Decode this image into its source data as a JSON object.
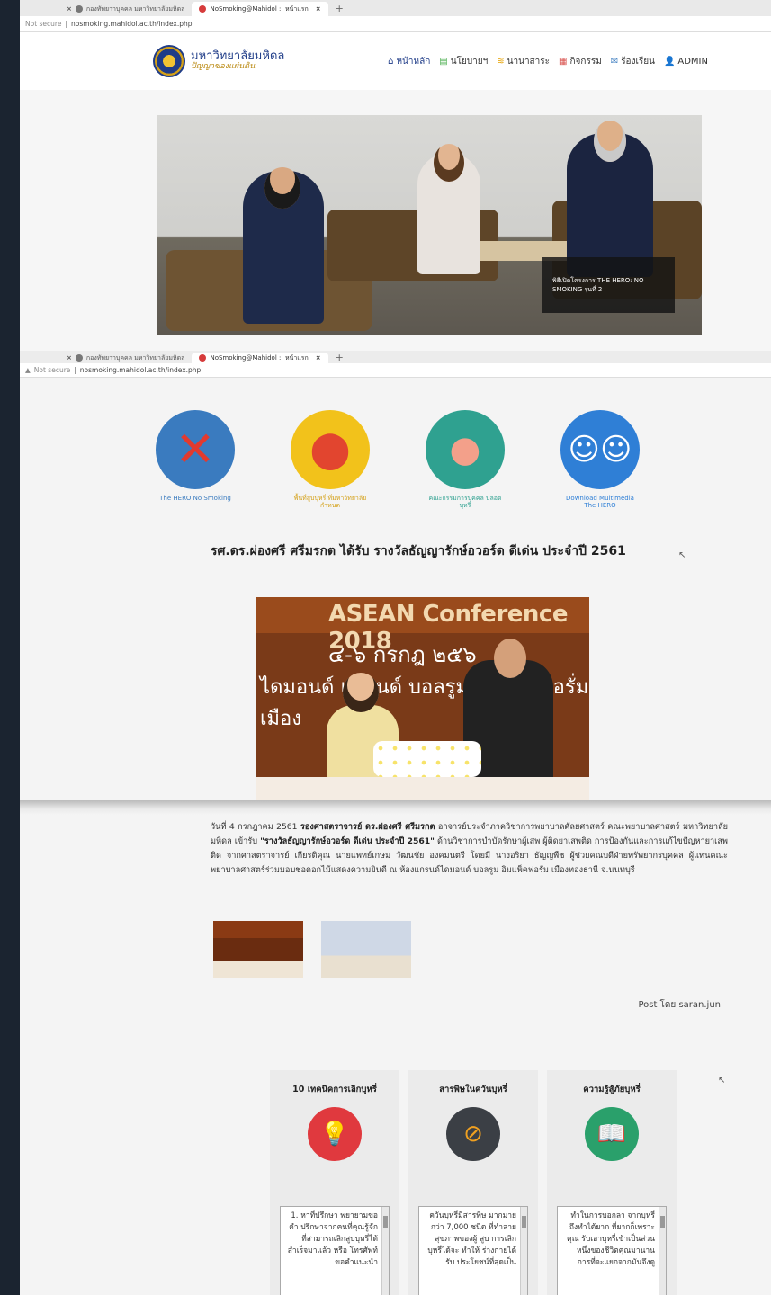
{
  "browser": {
    "tabs": [
      {
        "label": "กองทัพยาาบุคคล มหาวิทยาลัยมหิดล",
        "active": false
      },
      {
        "label": "NoSmoking@Mahidol :: หน้าแรก",
        "active": true
      }
    ],
    "tabs_bottom": [
      {
        "label": "กองทัพยาาบุคคล มหาวิทยาลัยมหิดล",
        "active": false
      },
      {
        "label": "NoSmoking@Mahidol :: หน้าแรก",
        "active": true
      }
    ],
    "security_label": "Not secure",
    "url": "nosmoking.mahidol.ac.th/index.php",
    "security_label_bottom": "Not secure",
    "url_bottom": "nosmoking.mahidol.ac.th/index.php"
  },
  "header": {
    "logo_main": "มหาวิทยาลัยมหิดล",
    "logo_sub": "ปัญญาของแผ่นดิน",
    "nav": [
      {
        "label": "หน้าหลัก",
        "icon": "home-icon"
      },
      {
        "label": "นโยบายฯ",
        "icon": "document-icon"
      },
      {
        "label": "นานาสาระ",
        "icon": "layers-icon"
      },
      {
        "label": "กิจกรรม",
        "icon": "calendar-icon"
      },
      {
        "label": "ร้องเรียน",
        "icon": "mail-icon"
      },
      {
        "label": "ADMIN",
        "icon": "user-icon"
      }
    ]
  },
  "banner": {
    "caption": "พิธีเปิดโครงการ THE HERO: NO SMOKING รุ่นที่ 2"
  },
  "quick_links": [
    {
      "label": "The HERO No Smoking",
      "icon": "no-smoking-icon",
      "color": "#3a7bbf",
      "label_color": "#3a7bbf"
    },
    {
      "label": "พื้นที่สูบบุหรี่ ที่มหาวิทยาลัยกำหนด",
      "icon": "map-pin-icon",
      "color": "#f2c21b",
      "label_color": "#d4a017"
    },
    {
      "label": "คณะกรรมการบุคคล ปลอดบุหรี่",
      "icon": "group-icon",
      "color": "#2fa190",
      "label_color": "#2fa190"
    },
    {
      "label": "Download Multimedia The HERO",
      "icon": "mascot-icon",
      "color": "#2f7fd6",
      "label_color": "#2f7fd6"
    }
  ],
  "post": {
    "title": "รศ.ดร.ผ่องศรี ศรีมรกต ได้รับ รางวัลธัญญารักษ์อวอร์ด ดีเด่น ประจำปี 2561",
    "image": {
      "banner_text": "ASEAN Conference 2018",
      "thai_line1": "๔-๖ กรกฎ ๒๕๖",
      "thai_line2": "ไดมอนด์ แกรนด์ บอลรูม อิมแพ็คฟอรั่ม เมือง"
    },
    "body_intro": "วันที่ 4 กรกฎาคม 2561 ",
    "body_name": "รองศาสตราจารย์ ดร.ผ่องศรี ศรีมรกต",
    "body_mid": " อาจารย์ประจำภาควิชาการพยาบาลศัลยศาสตร์ คณะพยาบาลศาสตร์ มหาวิทยาลัยมหิดล เข้ารับ ",
    "body_award": "\"รางวัลธัญญารักษ์อวอร์ด ดีเด่น ประจำปี 2561\"",
    "body_rest": " ด้านวิชาการบำบัดรักษาผู้เสพ ผู้ติดยาเสพติด การป้องกันและการแก้ไขปัญหายาเสพติด จากศาสตราจารย์ เกียรติคุณ นายแพทย์เกษม วัฒนชัย องคมนตรี โดยมี นางอริยา ธัญญพืช ผู้ช่วยคณบดีฝ่ายทรัพยากรบุคคล ผู้แทนคณะพยาบาลศาสตร์ร่วมมอบช่อดอกไม้แสดงความยินดี ณ ห้องแกรนด์ไดมอนด์ บอลรูม อิมแพ็คฟอรั่ม เมืองทองธานี จ.นนทบุรี",
    "posted_by": "Post โดย saran.jun"
  },
  "columns": [
    {
      "title": "10 เทคนิคการเลิกบุหรี่",
      "icon": "lightbulb-icon",
      "color": "#e0393e",
      "text": "1. หาที่ปรึกษา พยายามขอคำ ปรึกษาจากคนที่คุณรู้จัก ที่สามารถเลิกสูบบุหรี่ได้ สำเร็จมาแล้ว หรือ โทรศัพท์ ขอคำแนะนำ"
    },
    {
      "title": "สารพิษในควันบุหรี่",
      "icon": "ashtray-icon",
      "color": "#3b3f45",
      "text": "ควันบุหรี่มีสารพิษ มากมายกว่า 7,000 ชนิด ที่ทำลายสุขภาพของผู้ สูบ การเลิกบุหรี่ได้จะ ทำให้ ร่างกายได้รับ ประโยชน์ที่สุดเป็น"
    },
    {
      "title": "ความรู้สู้ภัยบุหรี่",
      "icon": "book-icon",
      "color": "#2aa06b",
      "text": "ทำในการบอกลา จากบุหรี่ถึงทำได้ยาก ที่ยากก็เพราะคุณ รับเอาบุหรี่เข้าเป็นส่วน หนึ่งของชีวิตคุณมานาน การที่จะแยกจากมันจึงดู"
    }
  ]
}
